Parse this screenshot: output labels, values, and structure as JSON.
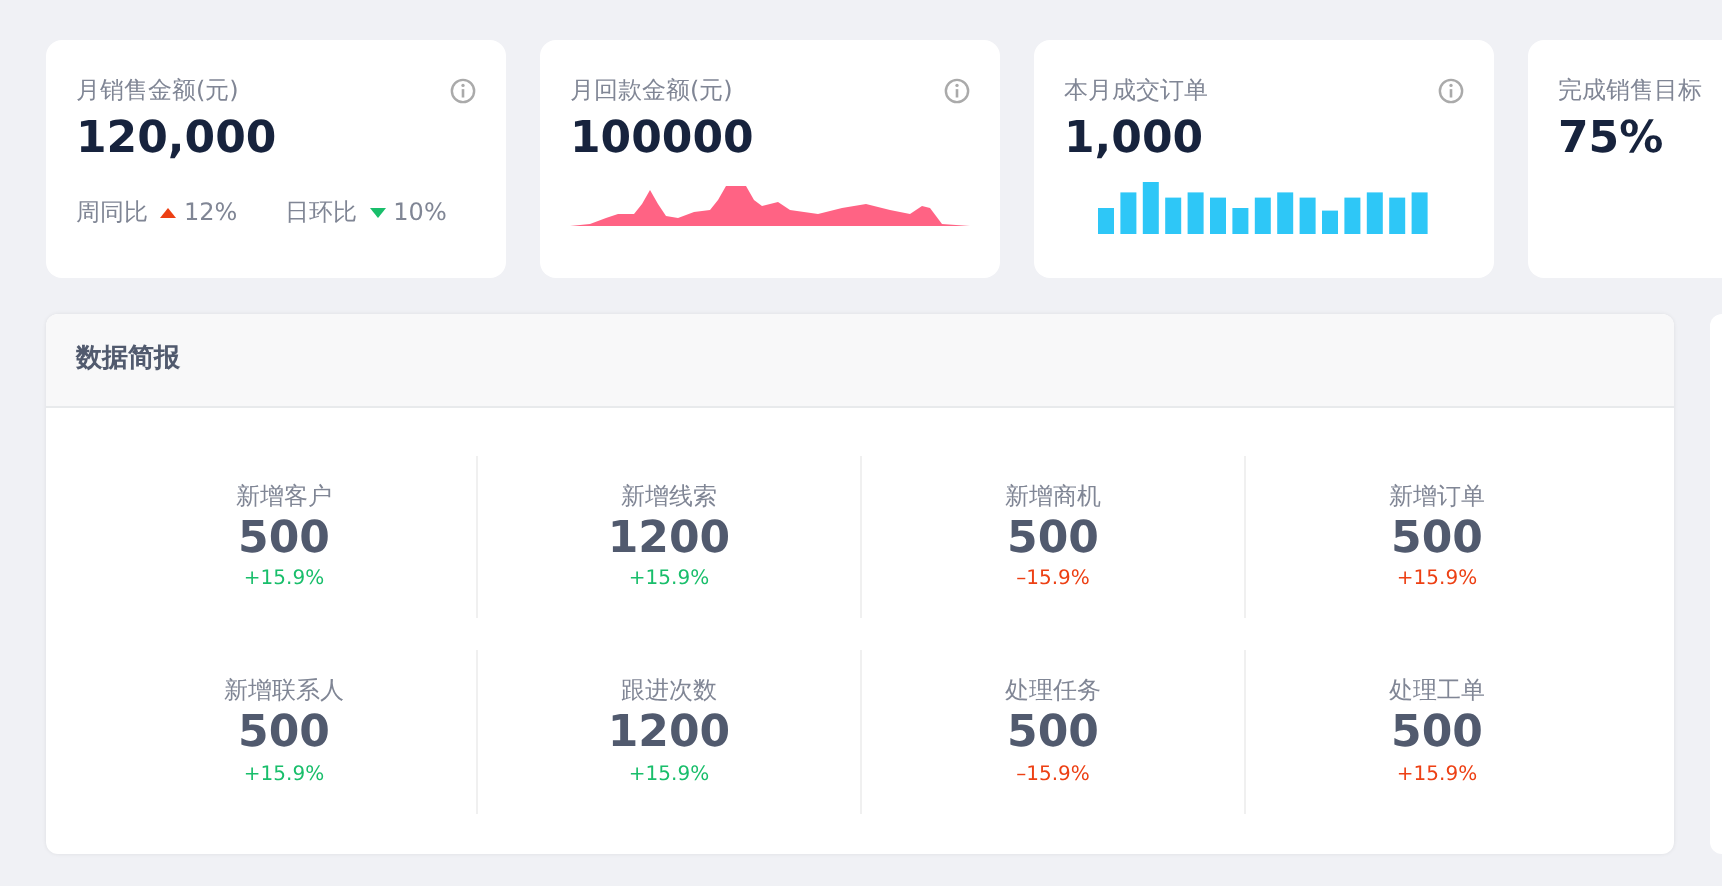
{
  "kpi_cards": [
    {
      "kind": "footer",
      "title": "月销售金额(元)",
      "value": "120,000",
      "comparisons": [
        {
          "label": "周同比",
          "kind": "up",
          "value": "12%"
        },
        {
          "label": "日环比",
          "kind": "down",
          "value": "10%"
        }
      ]
    },
    {
      "kind": "area",
      "title": "月回款金额(元)",
      "value": "100000"
    },
    {
      "kind": "bars",
      "title": "本月成交订单",
      "value": "1,000"
    },
    {
      "kind": "plain",
      "title": "完成销售目标",
      "value": "75%"
    }
  ],
  "report": {
    "title": "数据简报",
    "stats": [
      {
        "label": "新增客户",
        "value": "500",
        "change": "+15.9%",
        "color": "#19be6b"
      },
      {
        "label": "新增线索",
        "value": "1200",
        "change": "+15.9%",
        "color": "#19be6b"
      },
      {
        "label": "新增商机",
        "value": "500",
        "change": "–15.9%",
        "color": "#ed4014"
      },
      {
        "label": "新增订单",
        "value": "500",
        "change": "+15.9%",
        "color": "#ed4014"
      },
      {
        "label": "新增联系人",
        "value": "500",
        "change": "+15.9%",
        "color": "#19be6b"
      },
      {
        "label": "跟进次数",
        "value": "1200",
        "change": "+15.9%",
        "color": "#19be6b"
      },
      {
        "label": "处理任务",
        "value": "500",
        "change": "–15.9%",
        "color": "#ed4014"
      },
      {
        "label": "处理工单",
        "value": "500",
        "change": "+15.9%",
        "color": "#ed4014"
      }
    ]
  }
}
